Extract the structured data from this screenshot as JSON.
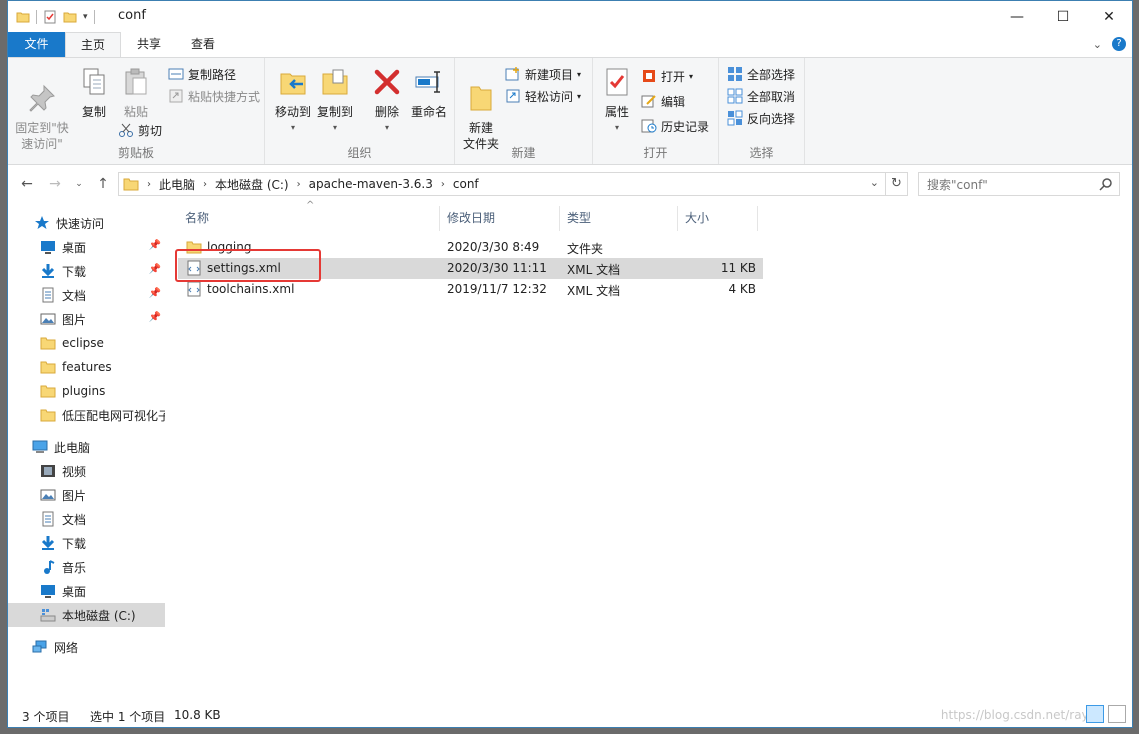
{
  "window": {
    "title": "conf",
    "controls": {
      "minimize": "—",
      "maximize": "☐",
      "close": "✕"
    }
  },
  "ribbon_tabs": [
    "文件",
    "主页",
    "共享",
    "查看"
  ],
  "ribbon": {
    "clipboard": {
      "label": "剪贴板",
      "pin": "固定到\"快\n速访问\"",
      "copy": "复制",
      "paste": "粘贴",
      "copy_path": "复制路径",
      "paste_shortcut": "粘贴快捷方式",
      "cut": "剪切"
    },
    "organize": {
      "label": "组织",
      "move_to": "移动到",
      "copy_to": "复制到",
      "delete": "删除",
      "rename": "重命名"
    },
    "new": {
      "label": "新建",
      "new_folder": "新建\n文件夹",
      "new_item": "新建项目",
      "easy_access": "轻松访问"
    },
    "open": {
      "label": "打开",
      "properties": "属性",
      "open": "打开",
      "edit": "编辑",
      "history": "历史记录"
    },
    "select": {
      "label": "选择",
      "select_all": "全部选择",
      "select_none": "全部取消",
      "invert": "反向选择"
    }
  },
  "address": {
    "crumbs": [
      "此电脑",
      "本地磁盘 (C:)",
      "apache-maven-3.6.3",
      "conf"
    ],
    "search_placeholder": "搜索\"conf\""
  },
  "nav": {
    "quick_access": "快速访问",
    "quick_items": [
      "桌面",
      "下载",
      "文档",
      "图片",
      "eclipse",
      "features",
      "plugins",
      "低压配电网可视化子"
    ],
    "this_pc": "此电脑",
    "pc_items": [
      "视频",
      "图片",
      "文档",
      "下载",
      "音乐",
      "桌面",
      "本地磁盘 (C:)"
    ],
    "network": "网络"
  },
  "columns": [
    "名称",
    "修改日期",
    "类型",
    "大小"
  ],
  "files": [
    {
      "name": "logging",
      "date": "2020/3/30 8:49",
      "type": "文件夹",
      "size": ""
    },
    {
      "name": "settings.xml",
      "date": "2020/3/30 11:11",
      "type": "XML 文档",
      "size": "11 KB"
    },
    {
      "name": "toolchains.xml",
      "date": "2019/11/7 12:32",
      "type": "XML 文档",
      "size": "4 KB"
    }
  ],
  "status": {
    "count": "3 个项目",
    "selected": "选中 1 个项目",
    "size": "10.8 KB",
    "watermark": "https://blog.csdn.net/rayl"
  },
  "colors": {
    "accent": "#1979ca",
    "selection": "#d9d9d9",
    "highlight": "#e53935"
  }
}
